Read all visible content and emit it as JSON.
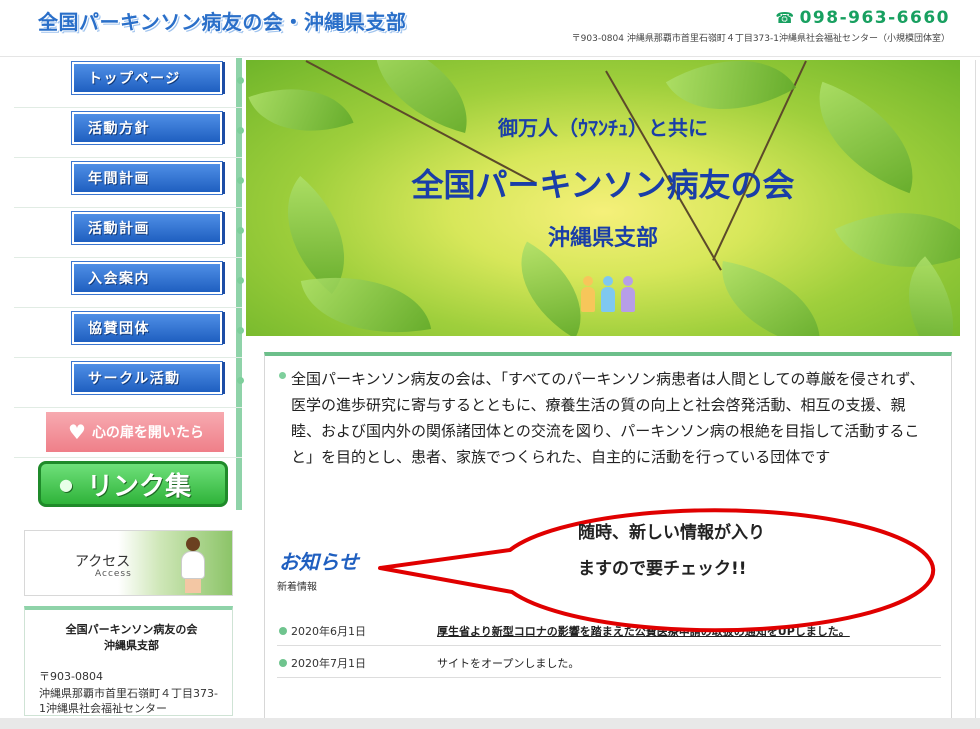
{
  "header": {
    "site_title": "全国パーキンソン病友の会・沖縄県支部",
    "phone": "098-963-6660",
    "address": "〒903-0804 沖縄県那覇市首里石嶺町４丁目373-1沖縄県社会福祉センター（小規模団体室）"
  },
  "sidebar": {
    "nav": [
      {
        "label": "トップページ"
      },
      {
        "label": "活動方針"
      },
      {
        "label": "年間計画"
      },
      {
        "label": "活動計画"
      },
      {
        "label": "入会案内"
      },
      {
        "label": "協賛団体"
      },
      {
        "label": "サークル活動"
      }
    ],
    "heart_button": "心の扉を開いたら",
    "links_button": "リンク集",
    "access": {
      "label": "アクセス",
      "sub": "Access"
    },
    "info": {
      "name_line1": "全国パーキンソン病友の会",
      "name_line2": "沖縄県支部",
      "zip": "〒903-0804",
      "address": "沖縄県那覇市首里石嶺町４丁目373-1沖縄県社会福祉センター"
    }
  },
  "hero": {
    "line1": "御万人（ｳﾏﾝﾁｭ）と共に",
    "line2": "全国パーキンソン病友の会",
    "line3": "沖縄県支部"
  },
  "main": {
    "mission": "全国パーキンソン病友の会は、「すべてのパーキンソン病患者は人間としての尊厳を侵されず、医学の進歩研究に寄与するとともに、療養生活の質の向上と社会啓発活動、相互の支援、親睦、および国内外の関係諸団体との交流を図り、パーキンソン病の根絶を目指して活動すること」を目的とし、患者、家族でつくられた、自主的に活動を行っている団体です",
    "news_title": "お知らせ",
    "news_sub": "新着情報",
    "news": [
      {
        "date": "2020年6月1日",
        "text": "厚生省より新型コロナの影響を踏まえた公費医療申請の取扱の通知をUPしました。"
      },
      {
        "date": "2020年7月1日",
        "text": "サイトをオープンしました。"
      }
    ]
  },
  "annotation": {
    "line1": "随時、新しい情報が入り",
    "line2": "ますので要チェック!!"
  },
  "colors": {
    "nav_blue": "#1f5fc0",
    "accent_green": "#6cbf8a",
    "annotation_red": "#e00000"
  }
}
